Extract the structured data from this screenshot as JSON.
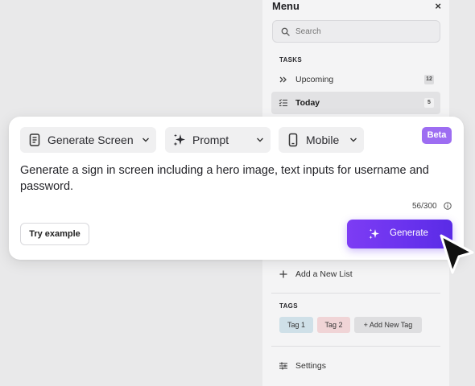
{
  "menu": {
    "title": "Menu",
    "close_label": "×",
    "search": {
      "placeholder": "Search"
    },
    "tasks_heading": "TASKS",
    "tasks": [
      {
        "label": "Upcoming",
        "count": "12",
        "icon": "double-chevron-right-icon"
      },
      {
        "label": "Today",
        "count": "5",
        "icon": "checklist-icon",
        "active": true
      }
    ],
    "add_list_label": "Add a New List",
    "tags_heading": "TAGS",
    "tags": [
      {
        "label": "Tag 1",
        "color": "#cfe0e8"
      },
      {
        "label": "Tag 2",
        "color": "#f0d4d6"
      },
      {
        "label": "+ Add New Tag",
        "color": "#dedee0"
      }
    ],
    "settings_label": "Settings"
  },
  "generator": {
    "screen_dropdown": "Generate Screen",
    "mode_dropdown": "Prompt",
    "device_dropdown": "Mobile",
    "badge": "Beta",
    "prompt": "Generate a sign in screen including a hero image, text inputs for username and password.",
    "counter": "56/300",
    "try_example_label": "Try example",
    "generate_label": "Generate"
  },
  "colors": {
    "accent": "#6a33ee",
    "badge": "#9d6df2",
    "background": "#e9e9ea",
    "panel": "#f4f4f5"
  }
}
